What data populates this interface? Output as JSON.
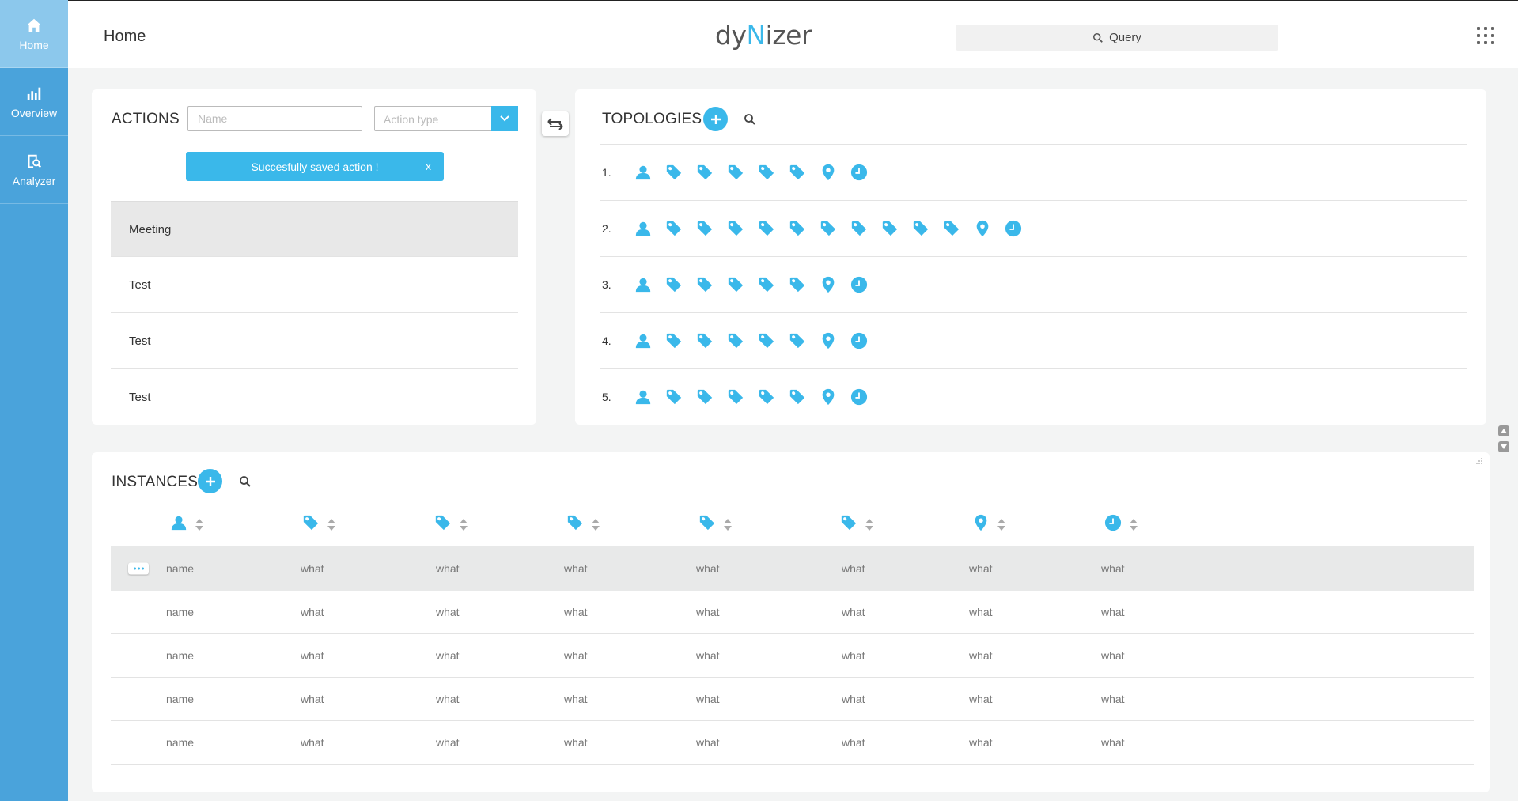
{
  "sidebar": {
    "items": [
      {
        "label": "Home",
        "icon": "home-icon",
        "active": true
      },
      {
        "label": "Overview",
        "icon": "bar-chart-icon",
        "active": false
      },
      {
        "label": "Analyzer",
        "icon": "analyzer-icon",
        "active": false
      }
    ]
  },
  "header": {
    "title": "Home",
    "logo_prefix": "dy",
    "logo_accent": "N",
    "logo_suffix": "izer",
    "search_placeholder": "Query"
  },
  "actions": {
    "title": "ACTIONS",
    "name_placeholder": "Name",
    "type_placeholder": "Action type",
    "toast": "Succesfully saved action !",
    "toast_close": "x",
    "items": [
      "Meeting",
      "Test",
      "Test",
      "Test"
    ]
  },
  "topologies": {
    "title": "TOPOLOGIES",
    "rows": [
      {
        "num": "1.",
        "icons": [
          "user",
          "tag",
          "tag",
          "tag",
          "tag",
          "tag",
          "pin",
          "clock"
        ]
      },
      {
        "num": "2.",
        "icons": [
          "user",
          "tag",
          "tag",
          "tag",
          "tag",
          "tag",
          "tag",
          "tag",
          "tag",
          "tag",
          "tag",
          "pin",
          "clock"
        ]
      },
      {
        "num": "3.",
        "icons": [
          "user",
          "tag",
          "tag",
          "tag",
          "tag",
          "tag",
          "pin",
          "clock"
        ]
      },
      {
        "num": "4.",
        "icons": [
          "user",
          "tag",
          "tag",
          "tag",
          "tag",
          "tag",
          "pin",
          "clock"
        ]
      },
      {
        "num": "5.",
        "icons": [
          "user",
          "tag",
          "tag",
          "tag",
          "tag",
          "tag",
          "pin",
          "clock"
        ]
      }
    ]
  },
  "instances": {
    "title": "INSTANCES",
    "columns": [
      "user",
      "tag",
      "tag",
      "tag",
      "tag",
      "tag",
      "pin",
      "clock"
    ],
    "rows": [
      [
        "name",
        "what",
        "what",
        "what",
        "what",
        "what",
        "what",
        "what"
      ],
      [
        "name",
        "what",
        "what",
        "what",
        "what",
        "what",
        "what",
        "what"
      ],
      [
        "name",
        "what",
        "what",
        "what",
        "what",
        "what",
        "what",
        "what"
      ],
      [
        "name",
        "what",
        "what",
        "what",
        "what",
        "what",
        "what",
        "what"
      ],
      [
        "name",
        "what",
        "what",
        "what",
        "what",
        "what",
        "what",
        "what"
      ]
    ]
  },
  "colors": {
    "accent": "#3ab8ea",
    "sidebar": "#4aa3db",
    "sidebar_active": "#8cc8ec"
  }
}
